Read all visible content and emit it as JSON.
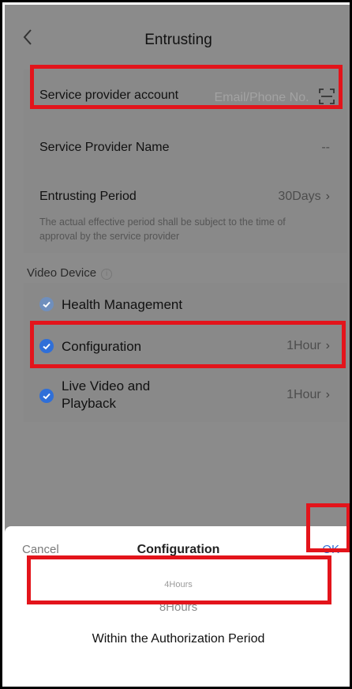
{
  "header": {
    "title": "Entrusting"
  },
  "form": {
    "account_label": "Service provider account",
    "account_placeholder": "Email/Phone No.",
    "name_label": "Service Provider Name",
    "name_value": "--",
    "period_label": "Entrusting Period",
    "period_value": "30Days",
    "period_note": "The actual effective period shall be subject to the time of approval by the service provider"
  },
  "video_device": {
    "section_label": "Video Device",
    "items": [
      {
        "label": "Health Management",
        "value": ""
      },
      {
        "label": "Configuration",
        "value": "1Hour"
      },
      {
        "label": "Live Video and Playback",
        "value": "1Hour"
      }
    ]
  },
  "sheet": {
    "cancel_label": "Cancel",
    "title": "Configuration",
    "ok_label": "OK",
    "options": [
      "4Hours",
      "8Hours",
      "Within the Authorization Period"
    ]
  },
  "colors": {
    "accent": "#2f6fd8",
    "highlight": "#e3141b",
    "overlay": "#8b8b8b"
  }
}
